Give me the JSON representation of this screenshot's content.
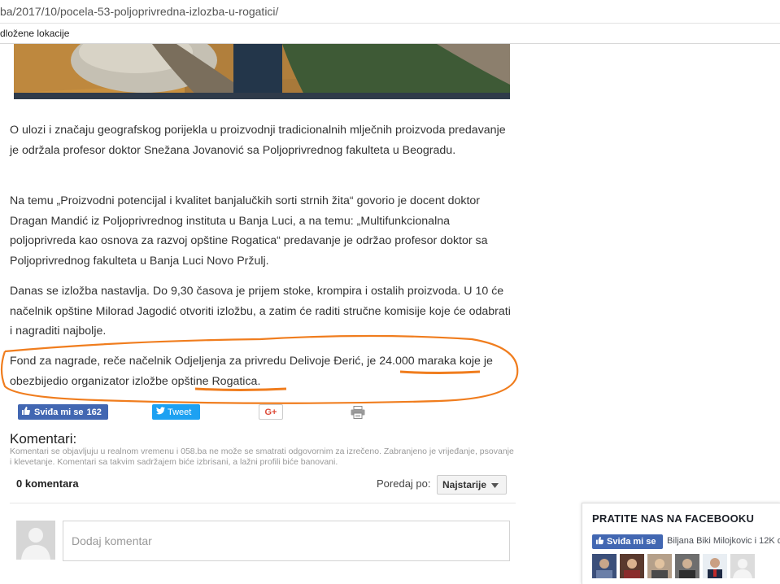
{
  "browser": {
    "url": "ba/2017/10/pocela-53-poljoprivredna-izlozba-u-rogatici/",
    "bookmark": "dložene lokacije"
  },
  "article": {
    "paragraphs": [
      "O ulozi i značaju geografskog porijekla u proizvodnji tradicionalnih mlječnih proizvoda predavanje je održala profesor doktor Snežana Jovanović sa Poljoprivrednog fakulteta u Beogradu.",
      "Na temu „Proizvodni potencijal i kvalitet banjalučkih sorti strnih žita“ govorio je docent doktor Dragan Mandić iz Poljoprivrednog instituta u Banja Luci, a na temu: „Multifunkcionalna poljoprivreda kao osnova za razvoj opštine Rogatica“ predavanje je održao profesor doktor sa Poljoprivrednog fakulteta u Banja Luci Novo Pržulj.",
      "Danas se izložba nastavlja. Do 9,30 časova je prijem stoke, krompira i ostalih proizvoda. U 10 će načelnik opštine Milorad Jagodić otvoriti izložbu, a zatim će raditi stručne komisije koje će odabrati i nagraditi najbolje."
    ],
    "fond": {
      "part1": "Fond za nagrade, reče načelnik Odjeljenja za privredu Delivoje Đerić, je ",
      "amount": "24.000 maraka",
      "part2": " koje je obezbijedio organizator izložbe ",
      "org": "opštine Rogatica",
      "part3": "."
    }
  },
  "share": {
    "fb_label": "Sviđa mi se",
    "fb_count": "162",
    "tweet_label": "Tweet",
    "gplus_label": "G+"
  },
  "comments": {
    "title": "Komentari:",
    "note": "Komentari se objavljuju u realnom vremenu i 058.ba ne može se smatrati odgovornim za izrečeno. Zabranjeno je vrijeđanje, psovanje i klevetanje. Komentari sa takvim sadržajem biće izbrisani, a lažni profili biće banovani.",
    "count": "0 komentara",
    "sort_label": "Poredaj po:",
    "sort_value": "Najstarije",
    "input_placeholder": "Dodaj komentar"
  },
  "facebook_widget": {
    "title": "PRATITE NAS NA FACEBOOKU",
    "like_label": "Sviđa mi se",
    "friends_text": "Biljana Biki Milojkovic i 12K o"
  },
  "colors": {
    "facebook": "#4267b2",
    "twitter": "#1da1f2",
    "highlight": "#f07d1e",
    "gplus": "#dd4b39"
  }
}
